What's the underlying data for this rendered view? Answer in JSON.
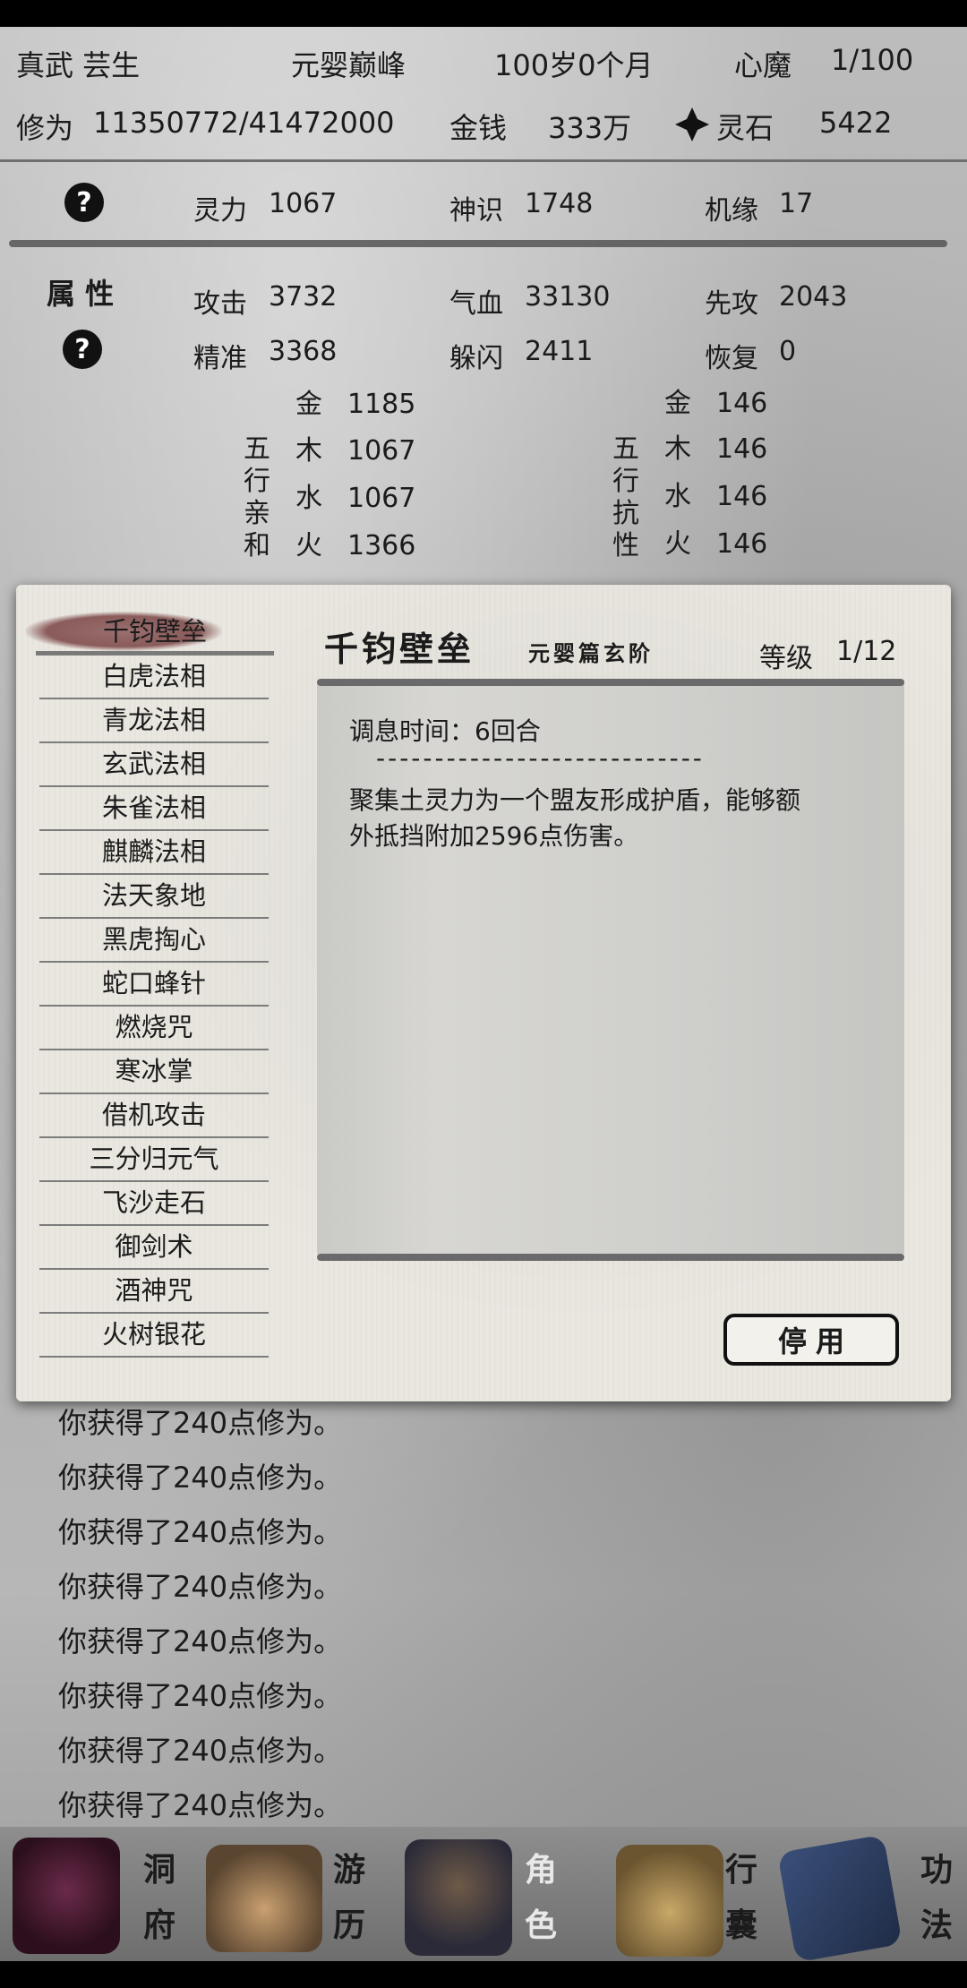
{
  "header": {
    "name": "真武 芸生",
    "realm": "元婴巅峰",
    "age": "100岁0个月",
    "demon_label": "心魔",
    "demon_value": "1/100",
    "cultivation_label": "修为",
    "cultivation_value": "11350772/41472000",
    "money_label": "金钱",
    "money_value": "333万",
    "spirit_stone_label": "灵石",
    "spirit_stone_value": "5422"
  },
  "stats": {
    "help_glyph": "?",
    "row1": [
      {
        "label": "灵力",
        "value": "1067"
      },
      {
        "label": "神识",
        "value": "1748"
      },
      {
        "label": "机缘",
        "value": "17"
      }
    ],
    "attr_heading": "属 性",
    "row2": [
      {
        "label": "攻击",
        "value": "3732"
      },
      {
        "label": "气血",
        "value": "33130"
      },
      {
        "label": "先攻",
        "value": "2043"
      }
    ],
    "row3": [
      {
        "label": "精准",
        "value": "3368"
      },
      {
        "label": "躲闪",
        "value": "2411"
      },
      {
        "label": "恢复",
        "value": "0"
      }
    ]
  },
  "wuxing": {
    "affinity_label": [
      "五",
      "行",
      "亲",
      "和"
    ],
    "resist_label": [
      "五",
      "行",
      "抗",
      "性"
    ],
    "affinity": [
      {
        "el": "金",
        "value": "1185"
      },
      {
        "el": "木",
        "value": "1067"
      },
      {
        "el": "水",
        "value": "1067"
      },
      {
        "el": "火",
        "value": "1366"
      }
    ],
    "resist": [
      {
        "el": "金",
        "value": "146"
      },
      {
        "el": "木",
        "value": "146"
      },
      {
        "el": "水",
        "value": "146"
      },
      {
        "el": "火",
        "value": "146"
      }
    ]
  },
  "modal": {
    "selected_skill": "千钧壁垒",
    "skills": [
      "白虎法相",
      "青龙法相",
      "玄武法相",
      "朱雀法相",
      "麒麟法相",
      "法天象地",
      "黑虎掏心",
      "蛇口蜂针",
      "燃烧咒",
      "寒冰掌",
      "借机攻击",
      "三分归元气",
      "飞沙走石",
      "御剑术",
      "酒神咒",
      "火树银花"
    ],
    "title": "千钧壁垒",
    "subtitle": "元婴篇玄阶",
    "level_label": "等级",
    "level_value": "1/12",
    "cooldown": "调息时间：6回合",
    "separator": "----------------------------",
    "description_line1": "聚集土灵力为一个盟友形成护盾，能够额",
    "description_line2": "外抵挡附加2596点伤害。",
    "stop_button": "停用"
  },
  "log": [
    "你获得了240点修为。",
    "你获得了240点修为。",
    "你获得了240点修为。",
    "你获得了240点修为。",
    "你获得了240点修为。",
    "你获得了240点修为。",
    "你获得了240点修为。",
    "你获得了240点修为。"
  ],
  "nav": [
    {
      "top": "洞",
      "bottom": "府",
      "icon": "cave-mansion-icon"
    },
    {
      "top": "游",
      "bottom": "历",
      "icon": "travel-icon"
    },
    {
      "top": "角",
      "bottom": "色",
      "icon": "character-icon"
    },
    {
      "top": "行",
      "bottom": "囊",
      "icon": "bag-icon"
    },
    {
      "top": "功",
      "bottom": "法",
      "icon": "technique-book-icon"
    }
  ],
  "colors": {
    "selected_brush": "#8a5b5b",
    "active_nav_label": "#e8e8e8"
  }
}
